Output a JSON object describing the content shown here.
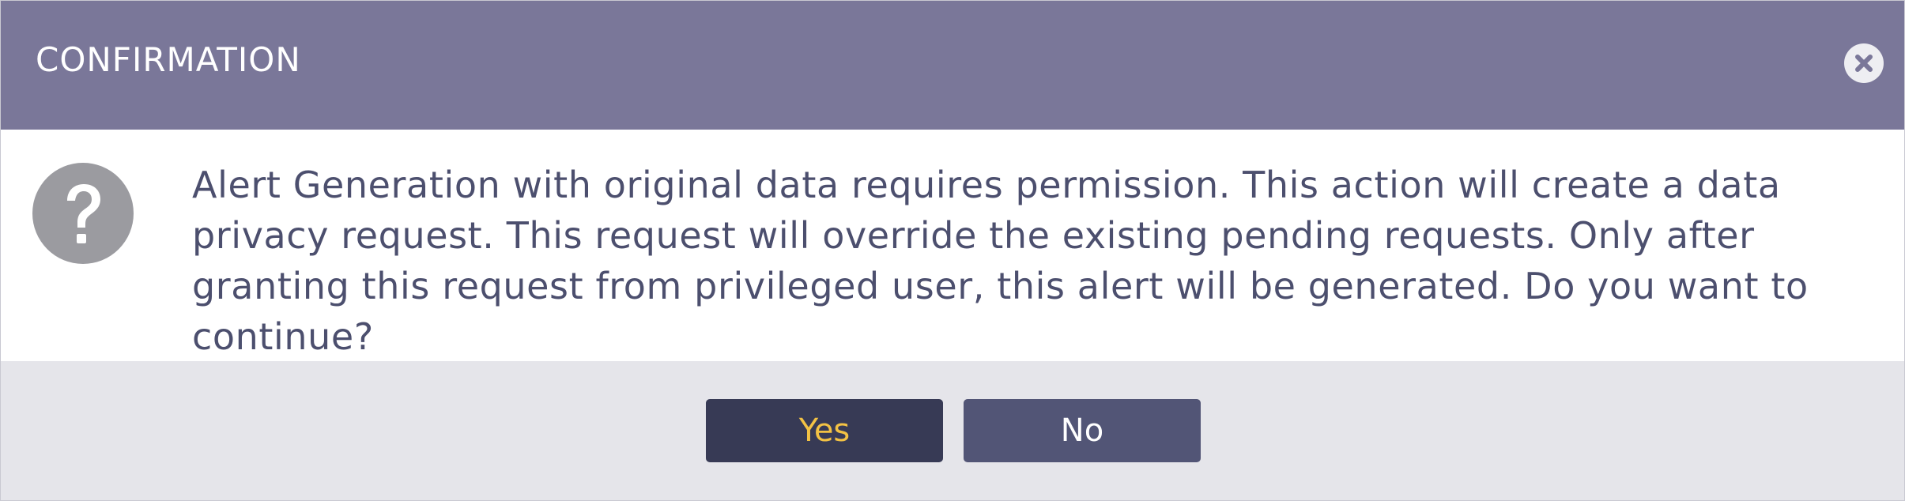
{
  "dialog": {
    "title": "CONFIRMATION",
    "message": "Alert Generation with original data requires permission. This action will create a data privacy request. This request will override the existing pending requests. Only after granting this request from privileged user, this alert will be generated. Do you want to continue?",
    "icon": "question-icon",
    "close_icon": "close-icon"
  },
  "buttons": {
    "yes_label": "Yes",
    "no_label": "No"
  },
  "colors": {
    "header": "#7a7799",
    "footer": "#e5e5ea",
    "yes_button": "#373a55",
    "yes_text": "#f3c244",
    "no_button": "#525576",
    "message_text": "#4c4f6e"
  }
}
